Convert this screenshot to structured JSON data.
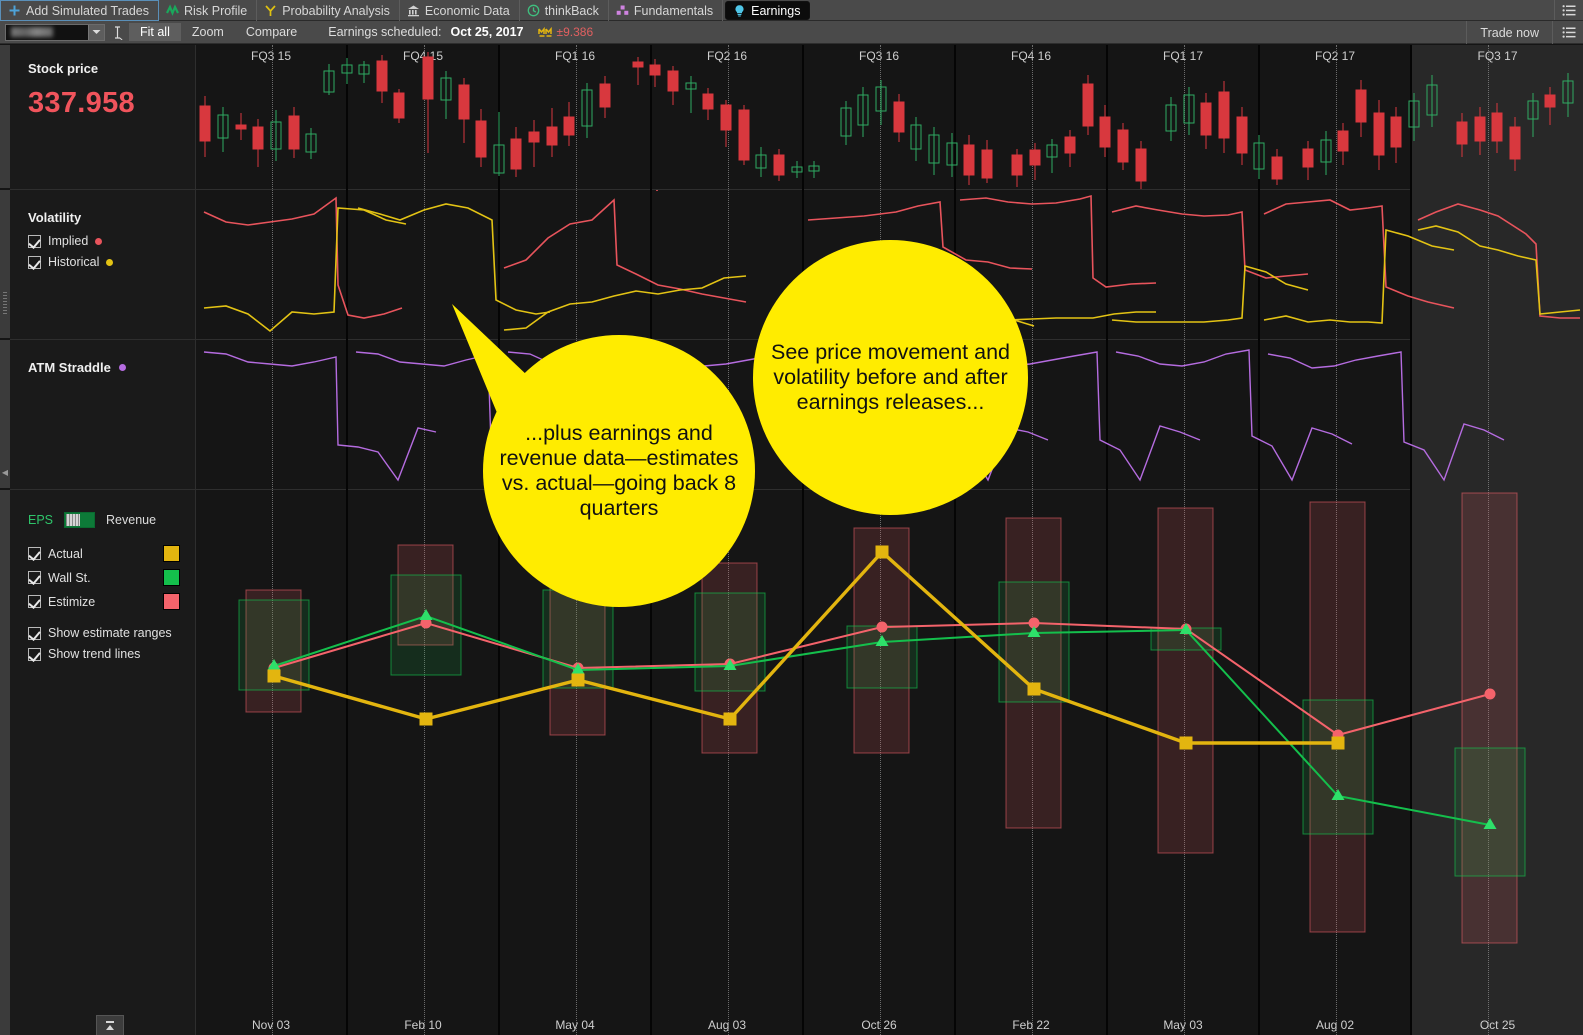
{
  "window": {
    "tabs": [
      {
        "label": "Add Simulated Trades",
        "icon": "plus-icon",
        "state": "outlined"
      },
      {
        "label": "Risk Profile",
        "icon": "risk-profile-icon",
        "state": "normal"
      },
      {
        "label": "Probability Analysis",
        "icon": "probability-fork-icon",
        "state": "normal"
      },
      {
        "label": "Economic Data",
        "icon": "bank-building-icon",
        "state": "normal"
      },
      {
        "label": "thinkBack",
        "icon": "clock-rewind-icon",
        "state": "normal"
      },
      {
        "label": "Fundamentals",
        "icon": "blocks-icon",
        "state": "normal"
      },
      {
        "label": "Earnings",
        "icon": "lightbulb-icon",
        "state": "active"
      }
    ],
    "menu_icon": "hamburger-list-icon"
  },
  "toolbar": {
    "symbol_value": "",
    "symbol_placeholder": "",
    "dropdown_icon": "chevron-down-icon",
    "link_icon": "chain-link-icon",
    "fit_all_label": "Fit all",
    "zoom_label": "Zoom",
    "compare_label": "Compare",
    "earnings_scheduled_label": "Earnings scheduled:",
    "earnings_date": "Oct 25, 2017",
    "move_icon": "expected-move-icon",
    "move_value": "±9.386",
    "move_color": "#e06060",
    "trade_now_label": "Trade now",
    "options_icon": "hamburger-list-icon"
  },
  "sections": {
    "stock_price": {
      "title": "Stock price",
      "value": "337.958",
      "value_color": "#f0545c"
    },
    "volatility": {
      "title": "Volatility",
      "items": [
        {
          "label": "Implied",
          "color": "#e8545c",
          "checked": true
        },
        {
          "label": "Historical",
          "color": "#e3c314",
          "checked": true
        }
      ]
    },
    "atm_straddle": {
      "title": "ATM Straddle",
      "color": "#b56ce0"
    },
    "earnings_legend": {
      "toggle_left_label": "EPS",
      "toggle_right_label": "Revenue",
      "toggle_active": "EPS",
      "toggle_active_color": "#2ec56a",
      "series": [
        {
          "label": "Actual",
          "color": "#e3b50f",
          "checked": true
        },
        {
          "label": "Wall St.",
          "color": "#14bf4c",
          "checked": true
        },
        {
          "label": "Estimize",
          "color": "#f4636b",
          "checked": true
        }
      ],
      "options": [
        {
          "label": "Show estimate ranges",
          "checked": true
        },
        {
          "label": "Show trend lines",
          "checked": true
        }
      ]
    }
  },
  "collapse_button": {
    "icon": "collapse-up-icon"
  },
  "chart_data": {
    "type": "line",
    "title": "Earnings — estimates vs. actual (EPS), 9 quarters",
    "quarters": [
      "FQ3 15",
      "FQ4 15",
      "FQ1 16",
      "FQ2 16",
      "FQ3 16",
      "FQ4 16",
      "FQ1 17",
      "FQ2 17",
      "FQ3 17"
    ],
    "dates": [
      "Nov 03",
      "Feb 10",
      "May 04",
      "Aug 03",
      "Oct 26",
      "Feb 22",
      "May 03",
      "Aug 02",
      "Oct 25"
    ],
    "xlabel": "",
    "ylabel": "EPS",
    "grid": false,
    "legend_position": "left-panel",
    "series": [
      {
        "name": "Actual",
        "color": "#e3b50f",
        "marker": "square",
        "values": [
          0.806,
          0.705,
          0.795,
          0.69,
          1.0,
          0.655,
          0.565,
          0.565,
          null
        ]
      },
      {
        "name": "Wall St.",
        "color": "#14bf4c",
        "marker": "triangle",
        "values": [
          0.822,
          0.905,
          0.8,
          0.795,
          0.85,
          0.87,
          0.875,
          0.435,
          0.36
        ]
      },
      {
        "name": "Estimize",
        "color": "#f4636b",
        "marker": "circle",
        "values": [
          0.818,
          0.888,
          0.795,
          0.8,
          0.88,
          0.885,
          0.872,
          0.56,
          0.62
        ]
      }
    ],
    "estimate_ranges": [
      {
        "quarter": "FQ3 15",
        "wallst_low": 0.7,
        "wallst_high": 0.898,
        "estimize_low": 0.678,
        "estimize_high": 0.88
      },
      {
        "quarter": "FQ4 15",
        "wallst_low": 0.795,
        "wallst_high": 1.0,
        "estimize_low": 0.81,
        "estimize_high": 0.975
      },
      {
        "quarter": "FQ1 16",
        "wallst_low": 0.712,
        "wallst_high": 0.88,
        "estimize_low": 0.64,
        "estimize_high": 0.915
      },
      {
        "quarter": "FQ2 16",
        "wallst_low": 0.7,
        "wallst_high": 0.905,
        "estimize_low": 0.612,
        "estimize_high": 0.93
      },
      {
        "quarter": "FQ3 16",
        "wallst_low": 0.79,
        "wallst_high": 0.905,
        "estimize_low": 0.69,
        "estimize_high": 0.96
      },
      {
        "quarter": "FQ4 16",
        "wallst_low": 0.735,
        "wallst_high": 0.945,
        "estimize_low": 0.645,
        "estimize_high": 1.0
      },
      {
        "quarter": "FQ1 17",
        "wallst_low": 0.855,
        "wallst_high": 0.89,
        "estimize_low": 0.64,
        "estimize_high": 1.0
      },
      {
        "quarter": "FQ2 17",
        "wallst_low": 0.355,
        "wallst_high": 0.608,
        "estimize_low": 0.27,
        "estimize_high": 1.02
      },
      {
        "quarter": "FQ3 17",
        "wallst_low": 0.24,
        "wallst_high": 0.545,
        "estimize_low": 0.215,
        "estimize_high": 1.045
      }
    ],
    "stock_price_panel": {
      "type": "candlestick",
      "up_color": "#2faa62",
      "down_color": "#d8383e"
    },
    "volatility_panel": {
      "type": "line",
      "series": [
        {
          "name": "Implied",
          "color": "#e8545c"
        },
        {
          "name": "Historical",
          "color": "#e3c314"
        }
      ]
    },
    "atm_straddle_panel": {
      "type": "line",
      "series": [
        {
          "name": "ATM Straddle",
          "color": "#b56ce0"
        }
      ]
    }
  },
  "callouts": [
    {
      "id": "callout-price-volatility",
      "text": "See price movement and volatility before and after earnings releases...",
      "bg": "#ffec00"
    },
    {
      "id": "callout-earnings-revenue",
      "text": "...plus earnings and revenue data—estimates vs. actual—going back 8 quarters",
      "bg": "#ffec00"
    }
  ]
}
